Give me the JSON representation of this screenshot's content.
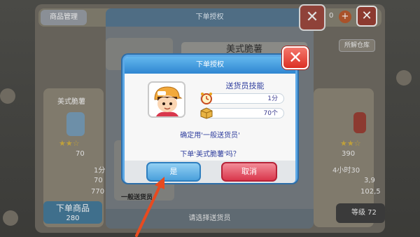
{
  "background": {
    "tab_label": "商品管理",
    "coins_left": "0",
    "unlock_button": "所解仓库",
    "left_card": {
      "title": "美式脆薯",
      "level": "70",
      "stats": [
        "1分",
        "70",
        "770"
      ]
    },
    "right_card": {
      "level": "390",
      "stats": [
        "4小时30",
        "3,9",
        "102,5"
      ]
    },
    "bottom_left_button": "下单商品",
    "bottom_left_sub": "280",
    "level_badge": "等级 72"
  },
  "order_modal": {
    "title": "下单授权",
    "product_name": "美式脆薯",
    "card_label": "一般送货员",
    "choose_prompt": "请选择送货员"
  },
  "dialog": {
    "title": "下单授权",
    "skill_title": "送货员技能",
    "skill_time": "1分",
    "skill_quantity": "70个",
    "confirm_line": "确定用'一般送货员'",
    "question_line": "下单'美式脆薯'吗？",
    "yes_label": "是",
    "cancel_label": "取消",
    "close_glyph": "✕"
  },
  "colors": {
    "dialog_border": "#5ca8e6",
    "text_blue": "#2f3e9e",
    "yes_button": "#4aa0db",
    "cancel_button": "#d9374c",
    "close_button": "#dc3024",
    "pointer_arrow": "#e84a1f"
  }
}
